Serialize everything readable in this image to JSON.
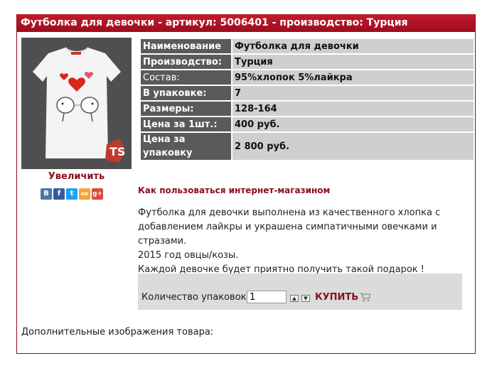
{
  "product": {
    "title": "Футболка для девочки - артикул: 5006401 - производство: Турция",
    "enlarge_label": "Увеличить",
    "how_to_label": "Как пользоваться интернет-магазином",
    "description": [
      "Футболка для девочки  выполнена из качественного хлопка с",
      "добавлением лайкры и украшена симпатичными овечками и стразами.",
      "2015 год овцы/козы.",
      "Каждой девочке будет приятно получить такой подарок !"
    ],
    "additional_images_label": "Дополнительные изображения товара:"
  },
  "social": [
    {
      "name": "vk",
      "glyph": "В",
      "color": "#4a76a8"
    },
    {
      "name": "facebook",
      "glyph": "f",
      "color": "#3b5998"
    },
    {
      "name": "twitter",
      "glyph": "t",
      "color": "#1da1f2"
    },
    {
      "name": "odnoklassniki",
      "glyph": "ок",
      "color": "#f2a33a"
    },
    {
      "name": "googleplus",
      "glyph": "g+",
      "color": "#dd4b39"
    }
  ],
  "properties": [
    {
      "key": "Наименование",
      "value": "Футболка для девочки"
    },
    {
      "key": "Производство:",
      "value": "Турция"
    },
    {
      "key": "Состав:",
      "value": "95%хлопок 5%лайкра"
    },
    {
      "key": "В упаковке:",
      "value": "7"
    },
    {
      "key": "Размеры:",
      "value": "128-164"
    },
    {
      "key": "Цена за 1шт.:",
      "value": "400 руб."
    },
    {
      "key": "Цена за упаковку",
      "value": "2 800 руб."
    }
  ],
  "order": {
    "quantity_label": "Количество упаковок:",
    "quantity_value": "1",
    "buy_label": "КУПИТЬ"
  },
  "colors": {
    "accent": "#8a0f1e",
    "title_bar": "#b5162a"
  }
}
